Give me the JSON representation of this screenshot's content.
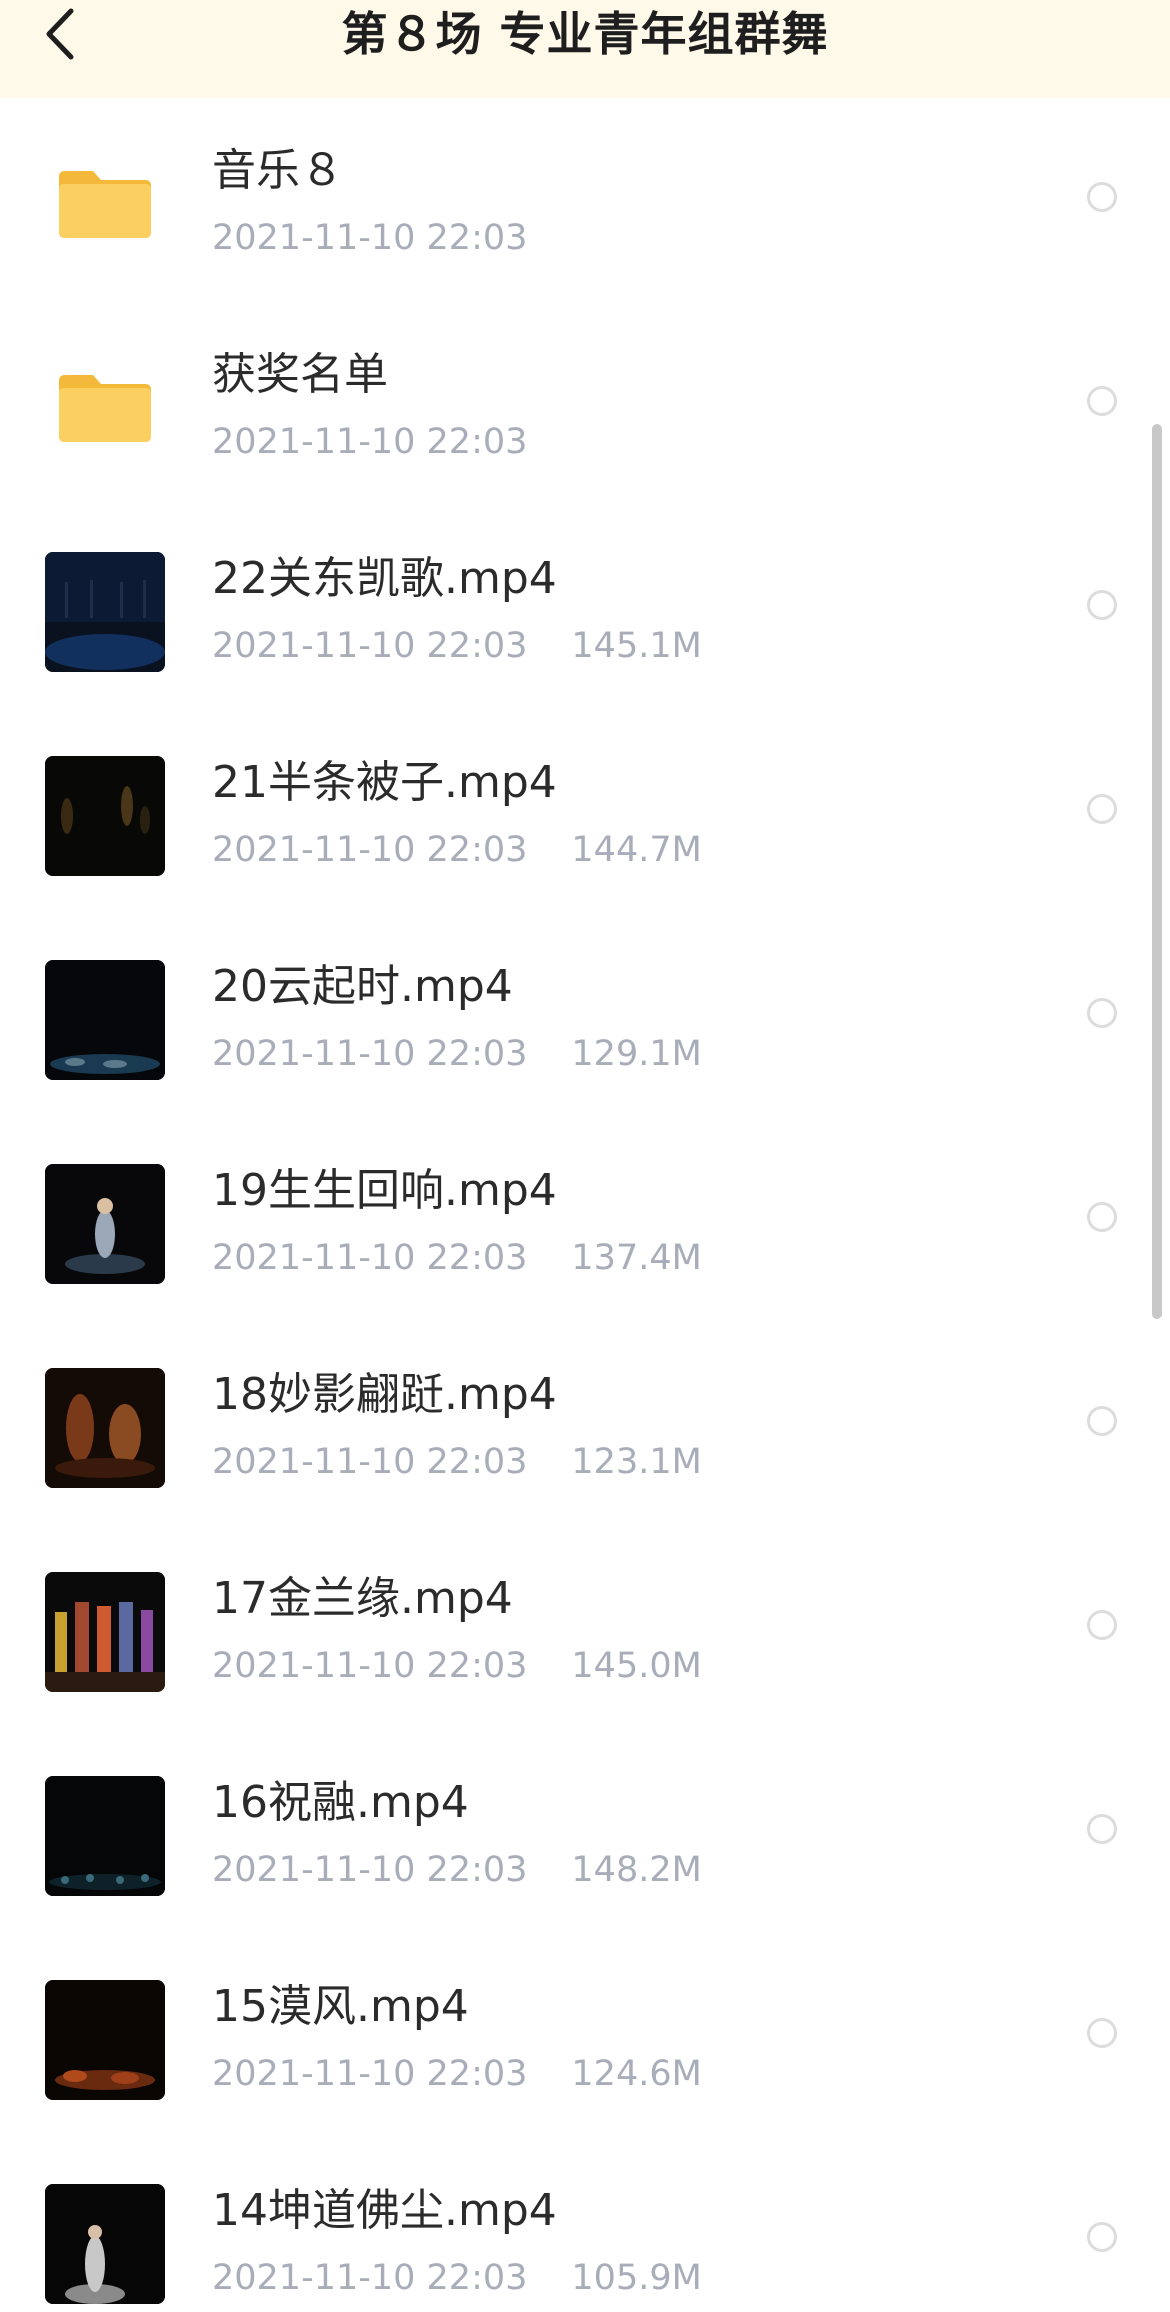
{
  "header": {
    "title": "第８场 专业青年组群舞",
    "back_icon": "chevron-left-icon",
    "background": "#fff9ea"
  },
  "colors": {
    "folder": "#f6c54a",
    "text": "#2b2b2b",
    "meta": "#a8adb9"
  },
  "items": [
    {
      "type": "folder",
      "name": "音乐８",
      "date": "2021-11-10 22:03",
      "size": ""
    },
    {
      "type": "folder",
      "name": "获奖名单",
      "date": "2021-11-10 22:03",
      "size": ""
    },
    {
      "type": "video",
      "name": "22关东凯歌.mp4",
      "date": "2021-11-10 22:03",
      "size": "145.1M"
    },
    {
      "type": "video",
      "name": "21半条被子.mp4",
      "date": "2021-11-10 22:03",
      "size": "144.7M"
    },
    {
      "type": "video",
      "name": "20云起时.mp4",
      "date": "2021-11-10 22:03",
      "size": "129.1M"
    },
    {
      "type": "video",
      "name": "19生生回响.mp4",
      "date": "2021-11-10 22:03",
      "size": "137.4M"
    },
    {
      "type": "video",
      "name": "18妙影翩跹.mp4",
      "date": "2021-11-10 22:03",
      "size": "123.1M"
    },
    {
      "type": "video",
      "name": "17金兰缘.mp4",
      "date": "2021-11-10 22:03",
      "size": "145.0M"
    },
    {
      "type": "video",
      "name": "16祝融.mp4",
      "date": "2021-11-10 22:03",
      "size": "148.2M"
    },
    {
      "type": "video",
      "name": "15漠风.mp4",
      "date": "2021-11-10 22:03",
      "size": "124.6M"
    },
    {
      "type": "video",
      "name": "14坤道佛尘.mp4",
      "date": "2021-11-10 22:03",
      "size": "105.9M"
    }
  ]
}
